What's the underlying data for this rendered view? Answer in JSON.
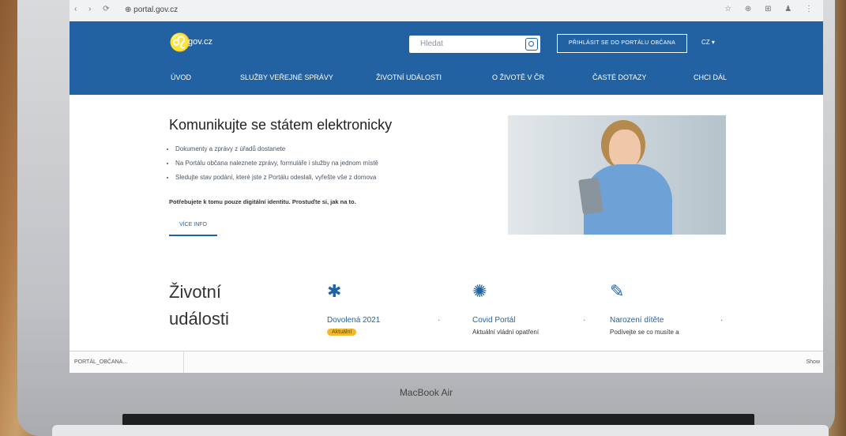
{
  "browser": {
    "nav_icons": "‹ › ⟳",
    "url": "⊕ portal.gov.cz",
    "ext_icons": "☆ ⊕ ⊞ ♟ ⋮"
  },
  "header": {
    "logo_icon": "lion-icon",
    "logo_text": "gov.cz",
    "search_placeholder": "Hledat",
    "login_label": "PŘIHLÁSIT SE DO PORTÁLU OBČANA",
    "lang": "CZ ▾",
    "menu": [
      "ÚVOD",
      "SLUŽBY VEŘEJNÉ SPRÁVY",
      "ŽIVOTNÍ UDÁLOSTI",
      "O ŽIVOTĚ V ČR",
      "ČASTÉ DOTAZY",
      "CHCI DÁL"
    ]
  },
  "hero": {
    "title": "Komunikujte se státem elektronicky",
    "bullets": [
      "Dokumenty a zprávy z úřadů dostanete",
      "Na Portálu občana naleznete zprávy, formuláře i služby na jednom místě",
      "Sledujte stav podání, které jste z Portálu odeslali, vyřešte vše z domova"
    ],
    "note": "Potřebujete k tomu pouze digitální identitu. Prostuďte si, jak na to.",
    "more_label": "VÍCE INFO"
  },
  "life_events": {
    "title_line1": "Životní",
    "title_line2": "události",
    "cards": [
      {
        "icon": "✱",
        "title": "Dovolená 2021",
        "badge": "Aktuální",
        "desc": ""
      },
      {
        "icon": "✺",
        "title": "Covid Portál",
        "badge": "",
        "desc": "Aktuální vládní opatření"
      },
      {
        "icon": "✎",
        "title": "Narození dítěte",
        "badge": "",
        "desc": "Podívejte se co musíte a"
      }
    ]
  },
  "download_bar": {
    "item": "PORTÁL_OBČANA...",
    "show_all": "Show"
  },
  "laptop_brand": "MacBook Air"
}
